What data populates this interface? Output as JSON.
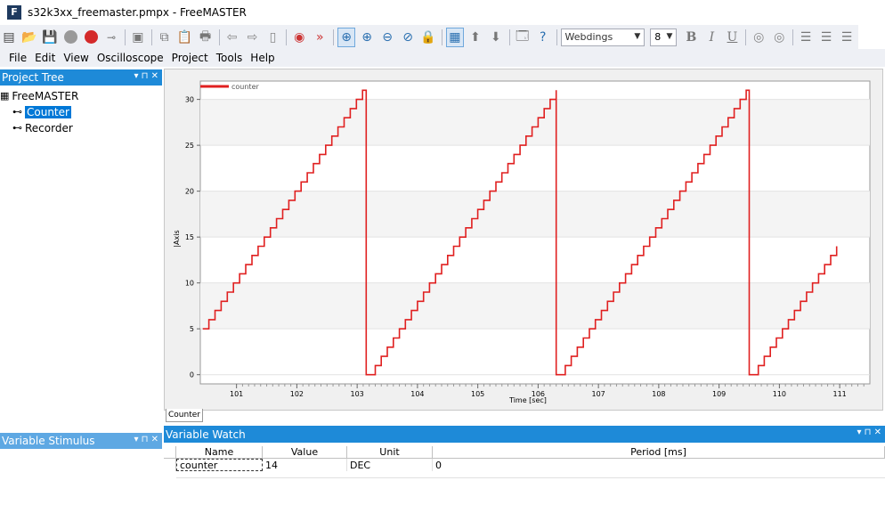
{
  "window": {
    "logo_letter": "F",
    "title": "s32k3xx_freemaster.pmpx - FreeMASTER"
  },
  "toolbar": {
    "font_name": "Webdings",
    "font_size": "8",
    "format_bold": "B",
    "format_italic": "I",
    "format_underline": "U"
  },
  "menu": [
    "File",
    "Edit",
    "View",
    "Oscilloscope",
    "Project",
    "Tools",
    "Help"
  ],
  "project_tree": {
    "title": "Project Tree",
    "controls": "▾ ⊓ ✕",
    "root": "FreeMASTER",
    "items": [
      "Counter",
      "Recorder"
    ]
  },
  "variable_stimulus": {
    "title": "Variable Stimulus",
    "controls": "▾ ⊓ ✕"
  },
  "chart_tab": "Counter",
  "variable_watch": {
    "title": "Variable Watch",
    "controls": "▾ ⊓ ✕",
    "columns": [
      "Name",
      "Value",
      "Unit",
      "Period [ms]"
    ],
    "rows": [
      {
        "name": "counter",
        "value": "14",
        "unit": "DEC",
        "period": "0"
      }
    ]
  },
  "chart_data": {
    "type": "line",
    "series": [
      {
        "name": "counter",
        "color": "#e02020",
        "segments": [
          {
            "x_start": 100.44,
            "x_end": 103.09,
            "y_start": 5,
            "y_end": 31
          },
          {
            "x_start": 103.2,
            "x_end": 106.3,
            "y_start": 0,
            "y_end": 31
          },
          {
            "x_start": 106.35,
            "x_end": 109.45,
            "y_start": 0,
            "y_end": 31
          },
          {
            "x_start": 109.55,
            "x_end": 110.95,
            "y_start": 0,
            "y_end": 14
          }
        ]
      }
    ],
    "x_ticks": [
      101,
      102,
      103,
      104,
      105,
      106,
      107,
      108,
      109,
      110,
      111
    ],
    "y_ticks": [
      0,
      5,
      10,
      15,
      20,
      25,
      30
    ],
    "xlim": [
      100.4,
      111.5
    ],
    "ylim": [
      -1,
      32
    ],
    "xlabel": "Time [sec]",
    "ylabel": "|Axis",
    "legend": "top-left",
    "grid": true
  }
}
